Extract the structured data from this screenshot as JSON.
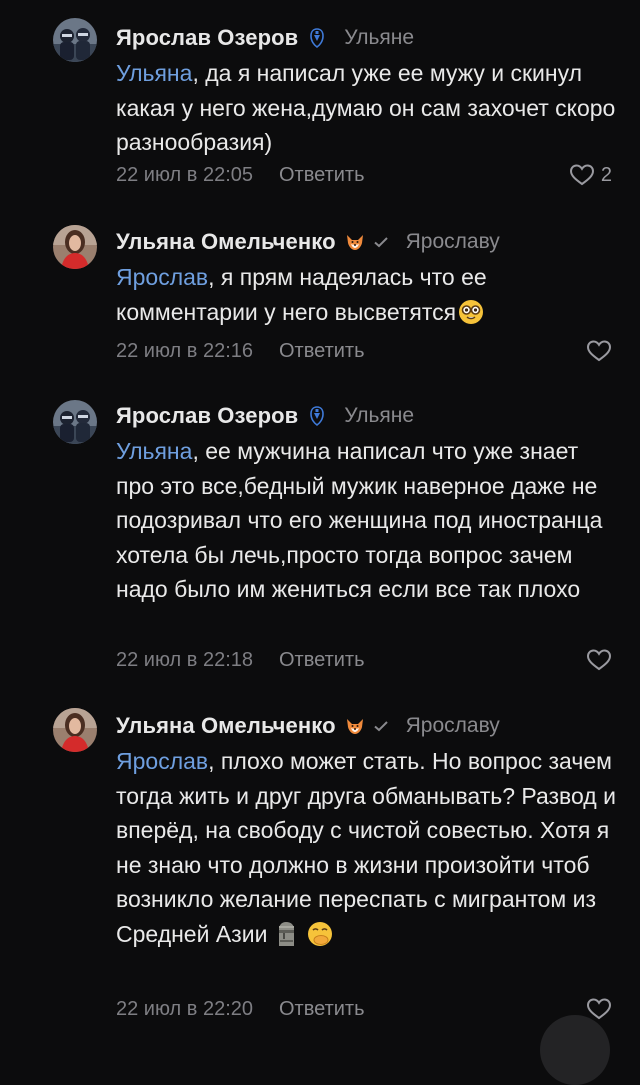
{
  "comments": [
    {
      "author": "Ярослав Озеров",
      "badge_icon": "dynamo-club-icon",
      "verified": false,
      "reply_to": "Ульяне",
      "mention": "Ульяна",
      "text": ", да я написал уже ее мужу и скинул какая у него жена,думаю он сам захочет скоро разнообразия)",
      "emojis": [],
      "timestamp": "22 июл в 22:05",
      "reply_label": "Ответить",
      "likes": "2"
    },
    {
      "author": "Ульяна Омельченко",
      "badge_icon": "fox-icon",
      "verified": true,
      "reply_to": "Ярославу",
      "mention": "Ярослав",
      "text": ", я прям надеялась что ее комментарии у него высветятся",
      "emojis": [
        "nerd-face-emoji"
      ],
      "timestamp": "22 июл в 22:16",
      "reply_label": "Ответить",
      "likes": ""
    },
    {
      "author": "Ярослав Озеров",
      "badge_icon": "dynamo-club-icon",
      "verified": false,
      "reply_to": "Ульяне",
      "mention": "Ульяна",
      "text": ", ее мужчина написал что уже знает про это все,бедный мужик наверное даже не подозривал что его женщина под иностранца хотела бы лечь,просто тогда вопрос зачем надо было им жениться если все так плохо",
      "emojis": [],
      "timestamp": "22 июл в 22:18",
      "reply_label": "Ответить",
      "likes": ""
    },
    {
      "author": "Ульяна Омельченко",
      "badge_icon": "fox-icon",
      "verified": true,
      "reply_to": "Ярославу",
      "mention": "Ярослав",
      "text": ", плохо может стать. Но вопрос зачем тогда жить и друг друга обманывать? Развод и вперёд, на свободу с чистой совестью. Хотя я не знаю что должно в жизни произойти чтоб возникло желание переспать с мигрантом из Средней Азии",
      "emojis": [
        "moai-emoji",
        "hand-over-mouth-emoji"
      ],
      "timestamp": "22 июл в 22:20",
      "reply_label": "Ответить",
      "likes": ""
    }
  ],
  "colors": {
    "background": "#0c0c0d",
    "mention": "#6f9fdf",
    "secondary_text": "#7e7e83"
  }
}
